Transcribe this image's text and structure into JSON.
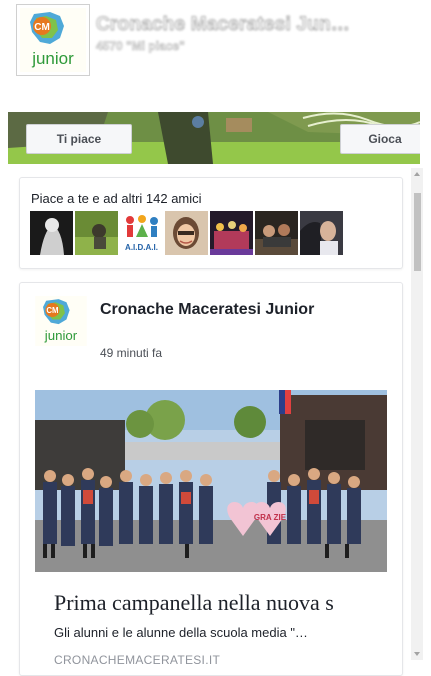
{
  "header": {
    "page_name": "Cronache Maceratesi Jun…",
    "likes_text": "4570 \"Mi piace\"",
    "logo": {
      "badge": "CM",
      "word": "junior"
    }
  },
  "cover": {
    "like_button": "Ti piace",
    "play_button": "Gioca"
  },
  "friends": {
    "text": "Piace a te e ad altri 142 amici",
    "aidai_label": "A.I.D.A.I."
  },
  "post": {
    "author": "Cronache Maceratesi Junior",
    "time": "49 minuti fa",
    "photo": {
      "heart_left": "",
      "heart_right": "GRA ZIE"
    },
    "link_title": "Prima campanella nella nuova s",
    "link_description": "Gli alunni e le alunne della scuola media \"…",
    "link_source": "CRONACHEMACERATESI.IT"
  },
  "colors": {
    "brand_green": "#3b9b3b",
    "brand_orange": "#f28c1b",
    "text_primary": "#1d2129",
    "text_secondary": "#4b4f56",
    "text_muted": "#90949c"
  },
  "icons": [
    "cm-junior-logo",
    "scroll-up-arrow-icon",
    "scroll-down-arrow-icon"
  ]
}
